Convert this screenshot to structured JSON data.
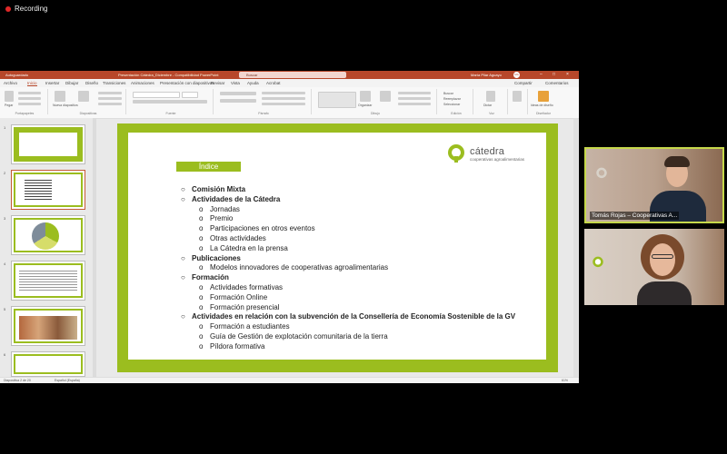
{
  "recording": {
    "label": "Recording"
  },
  "app": {
    "autosave": "Autoguardado",
    "doc_title": "Presentación Cátedra_Diciembre - Compatibilidad PowerPoint",
    "search_placeholder": "Buscar",
    "user": "María Pilar Aguayo",
    "user_initials": "MA"
  },
  "menu": {
    "items": [
      "Archivo",
      "Inicio",
      "Insertar",
      "Dibujar",
      "Diseño",
      "Transiciones",
      "Animaciones",
      "Presentación con diapositivas",
      "Revisar",
      "Vista",
      "Ayuda",
      "Acrobat"
    ],
    "active_index": 1,
    "share": "Compartir",
    "comments": "Comentarios"
  },
  "ribbon": {
    "groups": [
      "Portapapeles",
      "Diapositivas",
      "Fuente",
      "Párrafo",
      "Dibujo",
      "Edición",
      "Voz",
      "Confidencialidad",
      "Diseñador"
    ],
    "paste": "Pegar",
    "new_slide": "Nueva diapositiva",
    "reuse": "Volver a usar diapositivas",
    "arrange": "Organizar",
    "quick_styles": "Estilos rápidos",
    "find": "Buscar",
    "replace": "Reemplazar",
    "select": "Seleccionar",
    "dictate": "Dictar",
    "designer": "Ideas de diseño"
  },
  "thumbs": {
    "numbers": [
      "1",
      "2",
      "3",
      "4",
      "5",
      "6"
    ]
  },
  "status": {
    "slide_count": "Diapositiva 2 de 20",
    "language": "Español (España)",
    "zoom": "61%"
  },
  "slide": {
    "logo_name": "cátedra",
    "logo_sub": "cooperativas agroalimentarias",
    "heading": "Índice",
    "toc": [
      {
        "level": 1,
        "text": "Comisión Mixta"
      },
      {
        "level": 1,
        "text": "Actividades de la Cátedra"
      },
      {
        "level": 2,
        "text": "Jornadas"
      },
      {
        "level": 2,
        "text": "Premio"
      },
      {
        "level": 2,
        "text": "Participaciones en otros eventos"
      },
      {
        "level": 2,
        "text": "Otras actividades"
      },
      {
        "level": 2,
        "text": "La Cátedra en la prensa"
      },
      {
        "level": 1,
        "text": "Publicaciones"
      },
      {
        "level": 2,
        "text": "Modelos innovadores de cooperativas agroalimentarias"
      },
      {
        "level": 1,
        "text": "Formación"
      },
      {
        "level": 2,
        "text": "Actividades formativas"
      },
      {
        "level": 2,
        "text": "Formación Online"
      },
      {
        "level": 2,
        "text": "Formación presencial"
      },
      {
        "level": 1,
        "text": "Actividades en relación con la subvención de la Consellería de Economía Sostenible de la GV"
      },
      {
        "level": 2,
        "text": "Formación a estudiantes"
      },
      {
        "level": 2,
        "text": "Guía de Gestión de explotación comunitaria de la tierra"
      },
      {
        "level": 2,
        "text": "Píldora formativa"
      }
    ]
  },
  "participants": [
    {
      "name": "Tomás Rojas – Cooperativas A..."
    }
  ]
}
